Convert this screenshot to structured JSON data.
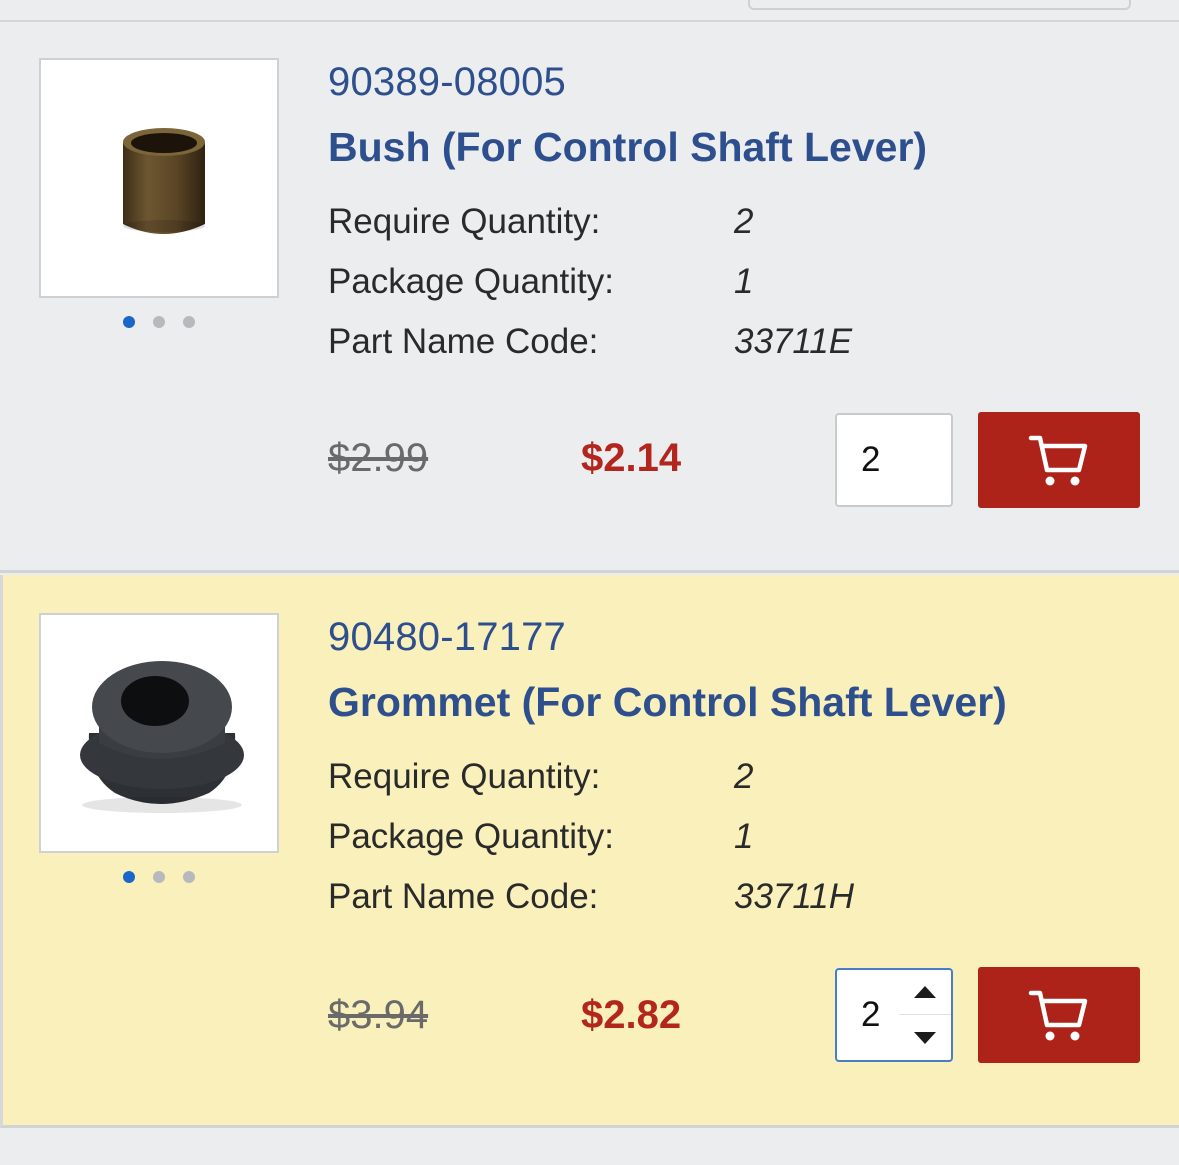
{
  "colors": {
    "link_blue": "#2d4f8e",
    "sale_red": "#b3261e",
    "cart_button": "#ad2219",
    "highlight_row": "#faf0bb",
    "page_bg": "#ecedef"
  },
  "labels": {
    "require_quantity": "Require Quantity:",
    "package_quantity": "Package Quantity:",
    "part_name_code": "Part Name Code:"
  },
  "parts": [
    {
      "part_number": "90389-08005",
      "title": "Bush (For Control Shaft Lever)",
      "require_quantity": "2",
      "package_quantity": "1",
      "part_name_code": "33711E",
      "old_price": "$2.99",
      "sale_price": "$2.14",
      "quantity": "2",
      "image_icon": "bronze-bushing-image",
      "carousel_dots": 3,
      "active_dot": 0,
      "cart_icon": "cart-icon"
    },
    {
      "part_number": "90480-17177",
      "title": "Grommet (For Control Shaft Lever)",
      "require_quantity": "2",
      "package_quantity": "1",
      "part_name_code": "33711H",
      "old_price": "$3.94",
      "sale_price": "$2.82",
      "quantity": "2",
      "image_icon": "rubber-grommet-image",
      "carousel_dots": 3,
      "active_dot": 0,
      "cart_icon": "cart-icon"
    }
  ]
}
